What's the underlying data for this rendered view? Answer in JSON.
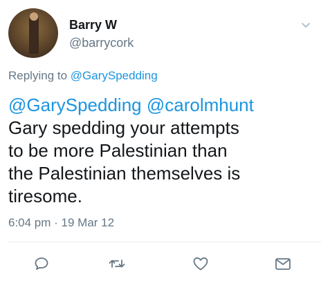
{
  "author": {
    "name": "Barry W",
    "handle": "@barrycork"
  },
  "reply": {
    "prefix": "Replying to ",
    "to": "@GarySpedding"
  },
  "tweet": {
    "mention_1": "@GarySpedding",
    "mention_2": "@carolmhunt",
    "line_1": "Gary spedding your attempts",
    "line_2": "to be more Palestinian than",
    "line_3": "the Palestinian themselves is",
    "line_4": "tiresome."
  },
  "meta": {
    "time": "6:04 pm",
    "separator": " · ",
    "date": "19 Mar 12"
  },
  "icons": {
    "menu": "chevron-down-icon",
    "reply": "reply-icon",
    "retweet": "retweet-icon",
    "like": "heart-icon",
    "message": "envelope-icon"
  },
  "colors": {
    "link": "#1b95e0",
    "secondary_text": "#657786",
    "primary_text": "#14171a",
    "divider": "#e6ecf0"
  }
}
